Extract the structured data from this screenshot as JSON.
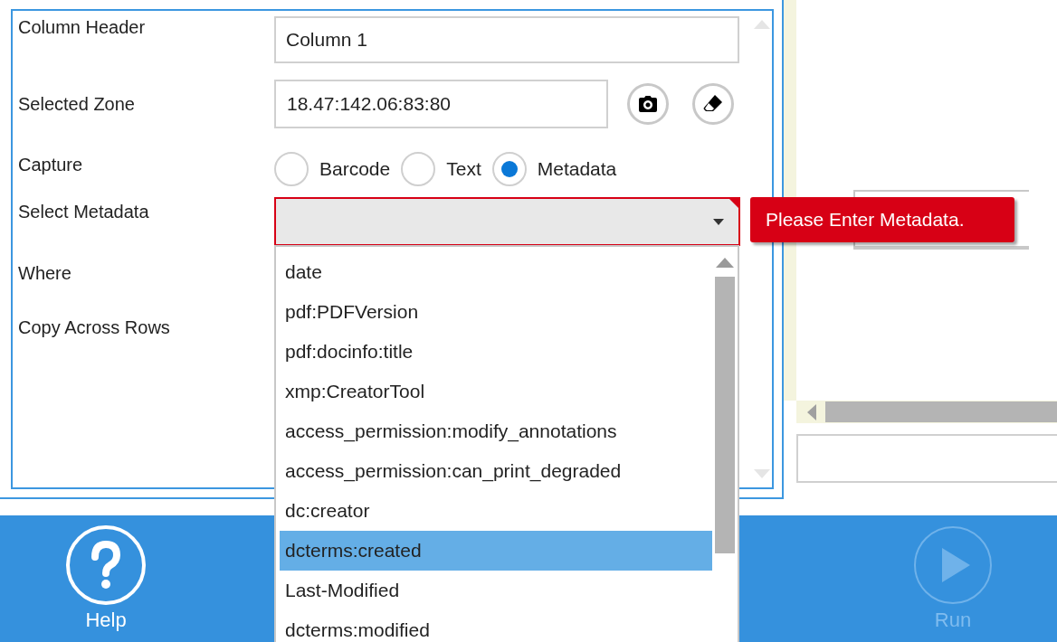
{
  "form": {
    "column_header": {
      "label": "Column Header",
      "value": "Column 1"
    },
    "selected_zone": {
      "label": "Selected Zone",
      "value": "18.47:142.06:83:80"
    },
    "capture": {
      "label": "Capture",
      "options": [
        {
          "label": "Barcode",
          "selected": false
        },
        {
          "label": "Text",
          "selected": false
        },
        {
          "label": "Metadata",
          "selected": true
        }
      ]
    },
    "select_metadata": {
      "label": "Select Metadata",
      "error": "Please Enter Metadata.",
      "expanded": true,
      "options": [
        {
          "label": "date",
          "selected": false
        },
        {
          "label": "pdf:PDFVersion",
          "selected": false
        },
        {
          "label": "pdf:docinfo:title",
          "selected": false
        },
        {
          "label": "xmp:CreatorTool",
          "selected": false
        },
        {
          "label": "access_permission:modify_annotations",
          "selected": false
        },
        {
          "label": "access_permission:can_print_degraded",
          "selected": false
        },
        {
          "label": "dc:creator",
          "selected": false
        },
        {
          "label": "dcterms:created",
          "selected": true
        },
        {
          "label": "Last-Modified",
          "selected": false
        },
        {
          "label": "dcterms:modified",
          "selected": false
        }
      ]
    },
    "where": {
      "label": "Where"
    },
    "copy_across_rows": {
      "label": "Copy Across Rows"
    }
  },
  "footer": {
    "buttons": [
      {
        "kind": "help",
        "label": "Help",
        "disabled": false
      },
      {
        "kind": "run",
        "label": "Run",
        "disabled": true
      }
    ]
  }
}
